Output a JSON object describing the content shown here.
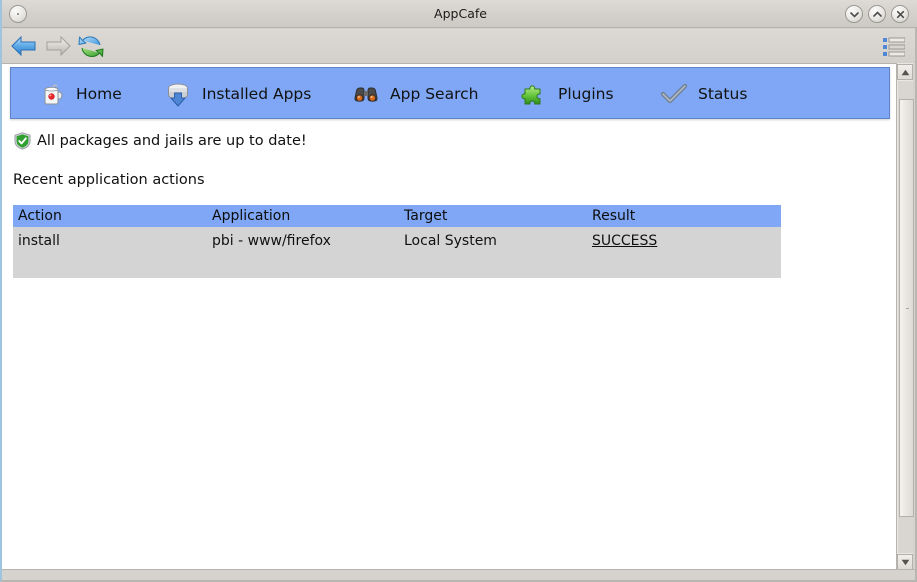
{
  "window": {
    "title": "AppCafe",
    "titlebar_buttons": [
      {
        "name": "window-menu-button",
        "icon": "window-menu-icon",
        "label": ""
      },
      {
        "name": "minimize-button",
        "icon": "chevron-down-icon",
        "label": ""
      },
      {
        "name": "maximize-button",
        "icon": "chevron-up-icon",
        "label": ""
      },
      {
        "name": "close-button",
        "icon": "close-x-icon",
        "label": ""
      }
    ]
  },
  "toolbar": {
    "back": {
      "label": "Back",
      "icon": "arrow-left-icon",
      "enabled": true
    },
    "forward": {
      "label": "Forward",
      "icon": "arrow-right-icon",
      "enabled": false
    },
    "refresh": {
      "label": "Refresh",
      "icon": "refresh-icon",
      "enabled": true
    },
    "menu": {
      "label": "Menu",
      "icon": "list-menu-icon"
    }
  },
  "navbar": {
    "background_color": "#7fa7f5",
    "items": [
      {
        "label": "Home",
        "icon": "coffee-mug-icon"
      },
      {
        "label": "Installed Apps",
        "icon": "package-install-icon"
      },
      {
        "label": "App Search",
        "icon": "binoculars-icon"
      },
      {
        "label": "Plugins",
        "icon": "puzzle-piece-icon"
      },
      {
        "label": "Status",
        "icon": "checkmark-icon"
      }
    ]
  },
  "status": {
    "icon": "green-shield-check-icon",
    "message": "All packages and jails are up to date!",
    "accent_color": "#2fa02f"
  },
  "recent_actions": {
    "section_title": "Recent application actions",
    "header_color": "#7fa7f5",
    "row_color": "#d4d4d4",
    "columns": [
      "Action",
      "Application",
      "Target",
      "Result"
    ],
    "rows": [
      {
        "action": "install",
        "application": "pbi - www/firefox",
        "target": "Local System",
        "result": "SUCCESS"
      }
    ]
  },
  "scrollbar": {
    "up_arrow": "▲",
    "down_arrow": "▼"
  }
}
